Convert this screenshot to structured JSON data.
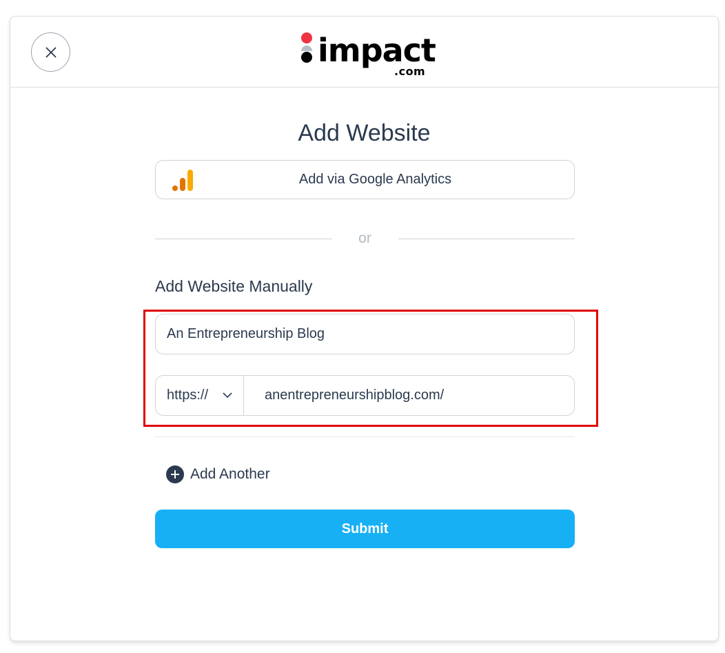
{
  "header": {
    "close_icon": "close-icon",
    "logo": {
      "word": "impact",
      "suffix": ".com",
      "dot_colors": [
        "#ee3342",
        "#b7bec6",
        "#000000"
      ]
    }
  },
  "main": {
    "title": "Add Website",
    "google_analytics_button": {
      "label": "Add via Google Analytics",
      "icon": "google-analytics-icon",
      "icon_colors": [
        "#e37400",
        "#f9ab00"
      ]
    },
    "separator_text": "or",
    "manual_section_label": "Add Website Manually",
    "website_name_input": {
      "value": "An Entrepreneurship Blog"
    },
    "url_group": {
      "protocol_selected": "https://",
      "url_value": "anentrepreneurshipblog.com/"
    },
    "add_another_label": "Add Another",
    "submit_label": "Submit"
  },
  "colors": {
    "primary": "#17b0f5",
    "text": "#2b3a4e",
    "highlight": "#e00000",
    "border": "#cfd4da"
  }
}
